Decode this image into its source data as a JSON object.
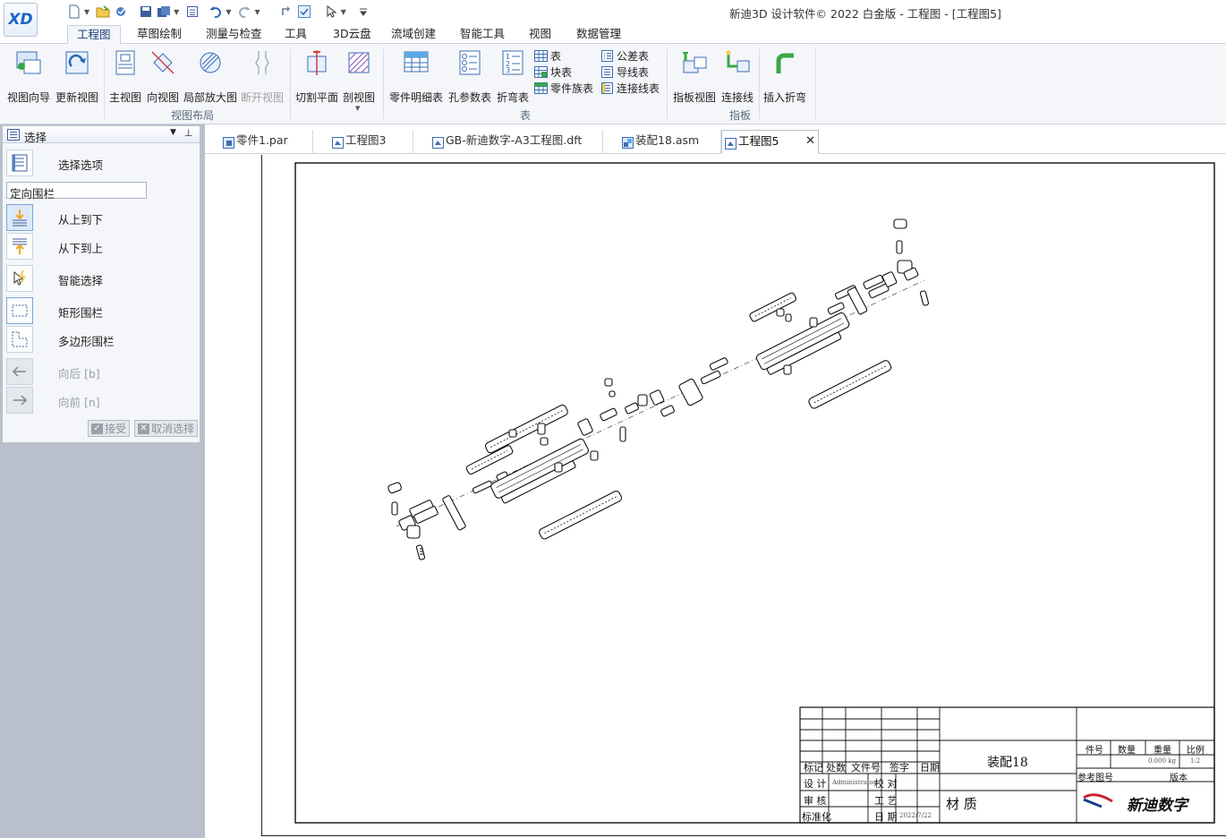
{
  "app": {
    "logo_text": "XD",
    "window_title": "新迪3D 设计软件© 2022 白金版 - 工程图 - [工程图5]"
  },
  "quick_access": {
    "icons": [
      "new-file-icon",
      "open-folder-icon",
      "recent-icon",
      "save-icon",
      "save-all-icon",
      "properties-icon",
      "undo-icon",
      "redo-icon",
      "reorder-icon",
      "check-icon",
      "select-arrow-icon",
      "customize-icon"
    ]
  },
  "ribbon_tabs": [
    {
      "label": "工程图",
      "active": true
    },
    {
      "label": "草图绘制"
    },
    {
      "label": "测量与检查"
    },
    {
      "label": "工具"
    },
    {
      "label": "3D云盘"
    },
    {
      "label": "流域创建"
    },
    {
      "label": "智能工具"
    },
    {
      "label": "视图"
    },
    {
      "label": "数据管理"
    }
  ],
  "ribbon": {
    "groups": {
      "view_layout": "视图布局",
      "table": "表",
      "pointer": "指板"
    },
    "buttons": {
      "view_wizard": "视图向导",
      "update_view": "更新视图",
      "main_view": "主视图",
      "direction_view": "向视图",
      "detail_view": "局部放大图",
      "break_view": "断开视图",
      "cut_plane": "切割平面",
      "section_view": "剖视图",
      "parts_list": "零件明细表",
      "hole_table": "孔参数表",
      "bend_table": "折弯表",
      "pointer_view": "指板视图",
      "connect_line": "连接线",
      "insert_bend": "插入折弯"
    },
    "small_buttons": {
      "table": "表",
      "block_table": "块表",
      "part_balloon": "零件族表",
      "tolerance_table": "公差表",
      "wire_table": "导线表",
      "connection_table": "连接线表"
    }
  },
  "left_panel": {
    "title": "选择",
    "select_options": "选择选项",
    "dropdown_value": "定向围栏",
    "items": {
      "top_to_bottom": "从上到下",
      "bottom_to_top": "从下到上",
      "smart_select": "智能选择",
      "rect_fence": "矩形围栏",
      "polygon_fence": "多边形围栏",
      "back": "向后 [b]",
      "forward": "向前 [n]"
    },
    "accept": "接受",
    "cancel_select": "取消选择"
  },
  "doc_tabs": [
    {
      "label": "零件1.par"
    },
    {
      "label": "工程图3"
    },
    {
      "label": "GB-新迪数字-A3工程图.dft"
    },
    {
      "label": "装配18.asm"
    },
    {
      "label": "工程图5",
      "active": true
    }
  ],
  "title_block": {
    "name": "装配18",
    "material": "材 质",
    "col_mark": "标记",
    "col_count": "处数",
    "col_file": "文件号",
    "col_sign": "签字",
    "col_date": "日期",
    "design": "设 计",
    "designer": "Administrator",
    "check": "校 对",
    "review": "审 核",
    "process": "工 艺",
    "standardize": "标准化",
    "date_label": "日 期",
    "date_value": "2022/7/22",
    "part_no": "件号",
    "quantity": "数量",
    "weight": "重量",
    "scale": "比例",
    "weight_value": "0.000 kg",
    "scale_value": "1:2",
    "ref_drawing": "参考图号",
    "version": "版本",
    "company_logo": "新迪数字"
  }
}
